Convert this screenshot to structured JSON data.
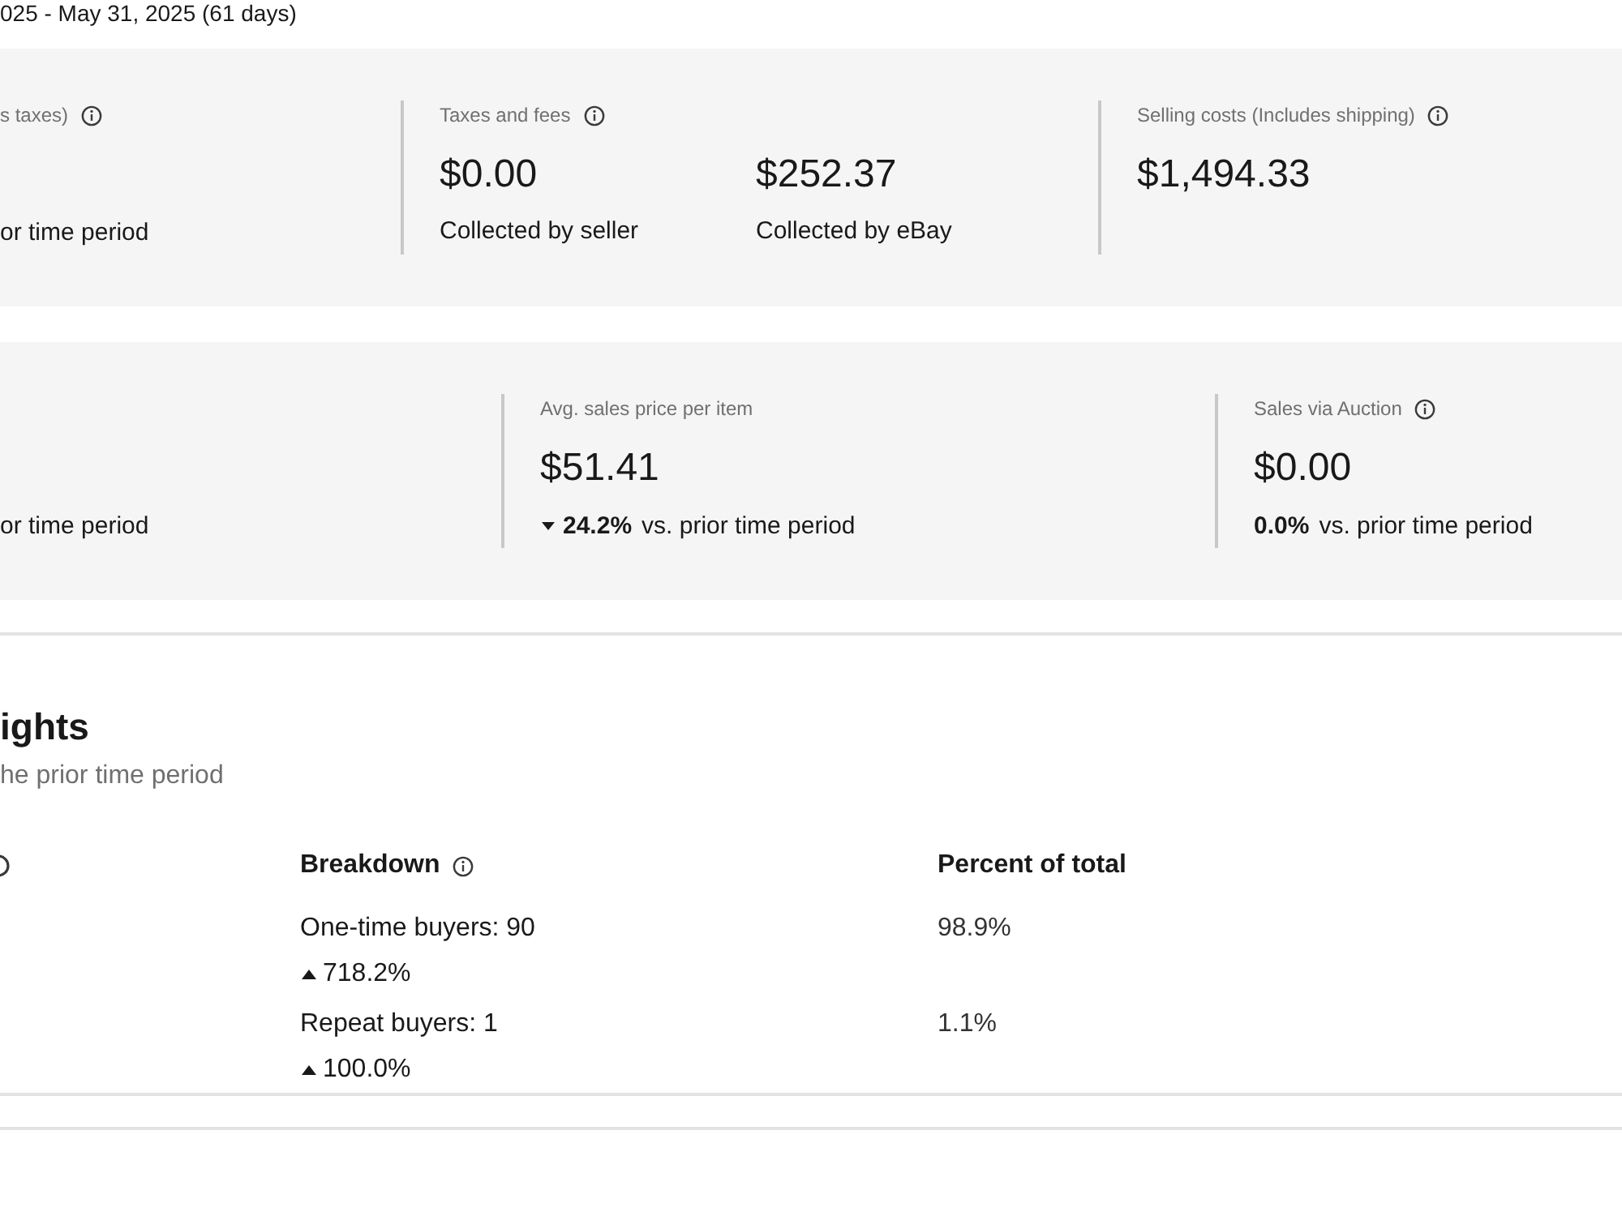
{
  "date_range": "025 - May 31, 2025 (61 days)",
  "summary_cards": [
    {
      "metrics": [
        {
          "label": "s taxes)",
          "info": true,
          "trend": {
            "text": "or time period"
          }
        },
        {
          "label": "Taxes and fees",
          "info": true,
          "values": [
            {
              "amount": "$0.00",
              "caption": "Collected by seller"
            },
            {
              "amount": "$252.37",
              "caption": "Collected by eBay"
            }
          ]
        },
        {
          "label": "Selling costs (Includes shipping)",
          "info": true,
          "values": [
            {
              "amount": "$1,494.33"
            }
          ]
        }
      ]
    },
    {
      "metrics": [
        {
          "trend": {
            "text": "or time period"
          }
        },
        {
          "label": "Avg. sales price per item",
          "info": false,
          "values": [
            {
              "amount": "$51.41"
            }
          ],
          "trend": {
            "falling": true,
            "percent": "24.2%",
            "text": "vs. prior time period"
          }
        },
        {
          "label": "Sales via Auction",
          "info": true,
          "values": [
            {
              "amount": "$0.00"
            }
          ],
          "trend": {
            "percent": "0.0%",
            "text": "vs. prior time period"
          }
        }
      ]
    }
  ],
  "insights": {
    "title": "ights",
    "subtitle": "he prior time period",
    "columns": [
      {
        "info": true
      },
      {
        "label": "Breakdown",
        "info": true
      },
      {
        "label": "Percent of total",
        "info": false
      }
    ],
    "rows": [
      {
        "breakdown": "One-time buyers: 90",
        "change": {
          "rising": true,
          "percent": "718.2%"
        },
        "percent_of_total": "98.9%"
      },
      {
        "breakdown": "Repeat buyers: 1",
        "change": {
          "rising": true,
          "percent": "100.0%"
        },
        "percent_of_total": "1.1%"
      }
    ]
  }
}
